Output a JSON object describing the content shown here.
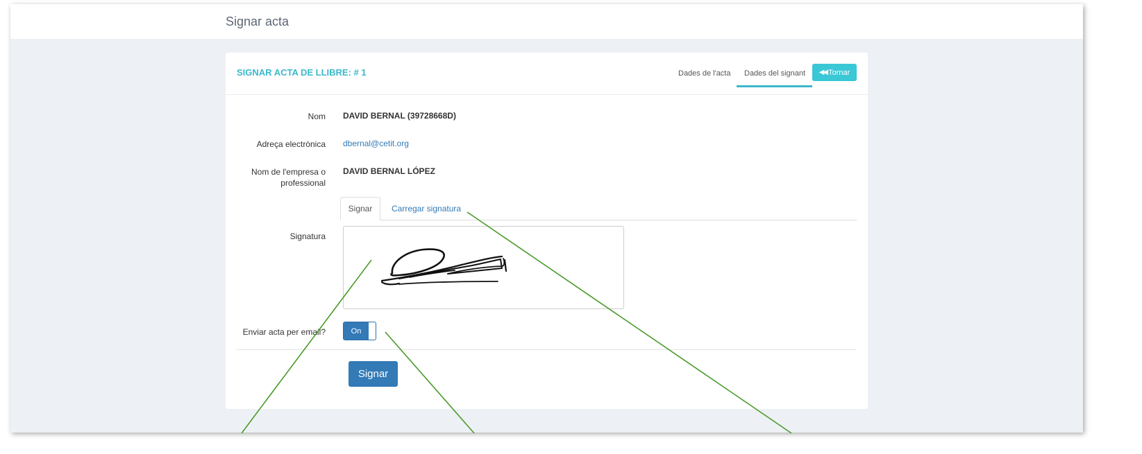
{
  "page": {
    "title": "Signar acta"
  },
  "panel": {
    "title": "SIGNAR ACTA DE LLIBRE: # 1",
    "tabs": [
      {
        "label": "Dades de l'acta",
        "active": false
      },
      {
        "label": "Dades del signant",
        "active": true
      }
    ],
    "back_button": {
      "label": "Tornar",
      "icon": "double-chevron-left-icon"
    }
  },
  "form": {
    "nom": {
      "label": "Nom",
      "value": "DAVID BERNAL (39728668D)"
    },
    "email": {
      "label": "Adreça electrònica",
      "value": "dbernal@cetit.org"
    },
    "empresa": {
      "label_line1": "Nom de l'empresa o",
      "label_line2": "professional",
      "value": "DAVID BERNAL LÓPEZ"
    },
    "signature_tabs": [
      {
        "label": "Signar",
        "active": true
      },
      {
        "label": "Carregar signatura",
        "active": false
      }
    ],
    "signature": {
      "label": "Signatura"
    },
    "send_email": {
      "label": "Enviar acta per email?",
      "toggle_text": "On",
      "checked": true
    },
    "submit_label": "Signar"
  },
  "colors": {
    "accent": "#3bb8cb",
    "primary": "#337ab7",
    "annotation": "#4a9a2a",
    "background": "#edf1f5"
  }
}
